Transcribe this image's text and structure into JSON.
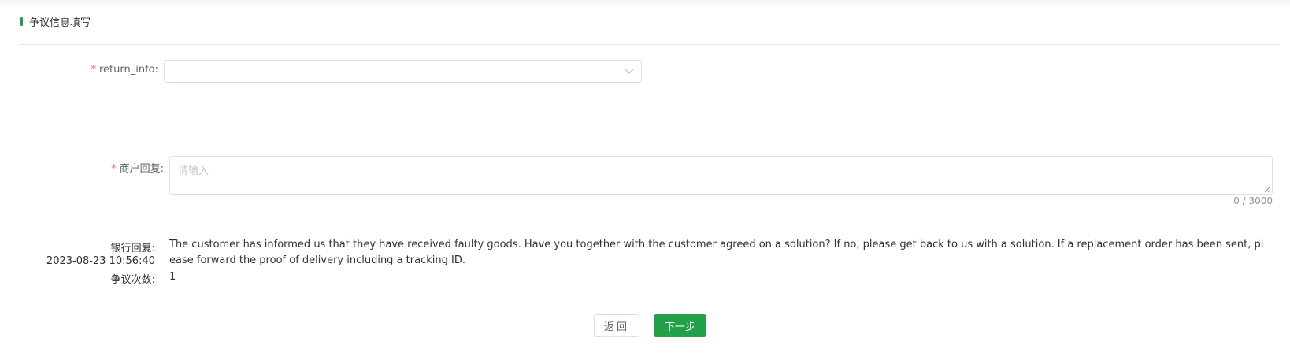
{
  "section": {
    "title": "争议信息填写"
  },
  "form": {
    "return_info": {
      "label": "return_info:",
      "value": ""
    },
    "merchant_reply": {
      "label": "商户回复:",
      "placeholder": "请输入",
      "count": "0 / 3000"
    }
  },
  "bank_reply": {
    "label": "银行回复:",
    "timestamp": "2023-08-23 10:56:40",
    "text": "The customer has informed us that they have received faulty goods. Have you together with the customer agreed on a solution? If no, please get back to us with a solution. If a replacement order has been sent, please forward the proof of delivery including a tracking ID."
  },
  "dispute_count": {
    "label": "争议次数:",
    "value": "1"
  },
  "buttons": {
    "back": "返回",
    "next": "下一步"
  },
  "colors": {
    "accent": "#22a04a",
    "required": "#f56c6c"
  },
  "icons": {
    "select_arrow": "chevron-down-icon",
    "textarea_resize": "resize-handle-icon"
  }
}
